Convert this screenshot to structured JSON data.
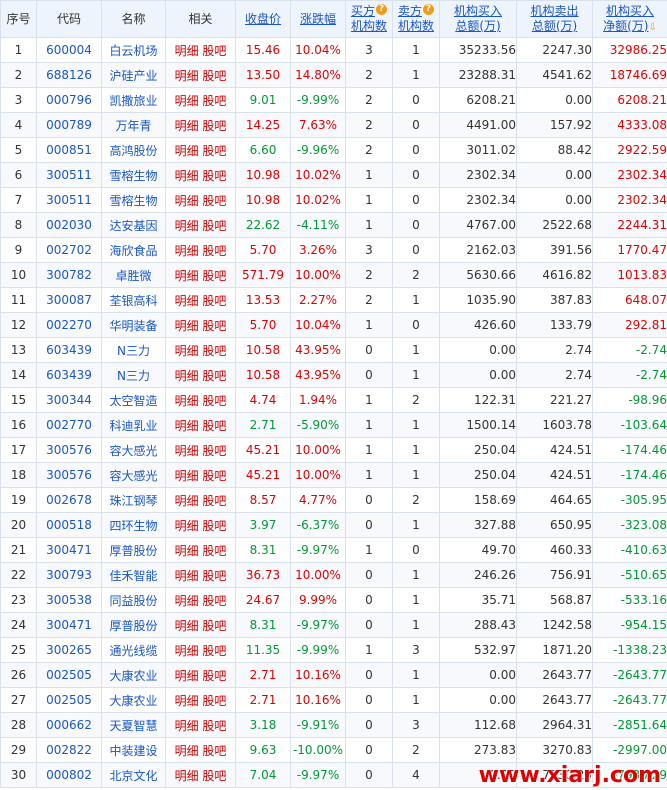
{
  "headers": {
    "seq": "序号",
    "code": "代码",
    "name": "名称",
    "related": "相关",
    "close": "收盘价",
    "change": "涨跌幅",
    "buy_inst": [
      "买方",
      "机构数"
    ],
    "sell_inst": [
      "卖方",
      "机构数"
    ],
    "inst_buy_total": [
      "机构买入",
      "总额(万)"
    ],
    "inst_sell_total": [
      "机构卖出",
      "总额(万)"
    ],
    "inst_net": [
      "机构买入",
      "净额(万)"
    ]
  },
  "related_links": {
    "detail": "明细",
    "forum": "股吧"
  },
  "colors": {
    "up": "#e40000",
    "down": "#009933",
    "link": "#1a56c8"
  },
  "rows": [
    {
      "seq": "1",
      "code": "600004",
      "name": "白云机场",
      "close": "15.46",
      "change": "10.04%",
      "buy": "3",
      "sell": "1",
      "buy_total": "35233.56",
      "sell_total": "2247.30",
      "net": "32986.25",
      "dir": "up",
      "netdir": "up"
    },
    {
      "seq": "2",
      "code": "688126",
      "name": "沪硅产业",
      "close": "13.50",
      "change": "14.80%",
      "buy": "2",
      "sell": "1",
      "buy_total": "23288.31",
      "sell_total": "4541.62",
      "net": "18746.69",
      "dir": "up",
      "netdir": "up"
    },
    {
      "seq": "3",
      "code": "000796",
      "name": "凯撒旅业",
      "close": "9.01",
      "change": "-9.99%",
      "buy": "2",
      "sell": "0",
      "buy_total": "6208.21",
      "sell_total": "0.00",
      "net": "6208.21",
      "dir": "down",
      "netdir": "up"
    },
    {
      "seq": "4",
      "code": "000789",
      "name": "万年青",
      "close": "14.25",
      "change": "7.63%",
      "buy": "2",
      "sell": "0",
      "buy_total": "4491.00",
      "sell_total": "157.92",
      "net": "4333.08",
      "dir": "up",
      "netdir": "up"
    },
    {
      "seq": "5",
      "code": "000851",
      "name": "高鸿股份",
      "close": "6.60",
      "change": "-9.96%",
      "buy": "2",
      "sell": "0",
      "buy_total": "3011.02",
      "sell_total": "88.42",
      "net": "2922.59",
      "dir": "down",
      "netdir": "up"
    },
    {
      "seq": "6",
      "code": "300511",
      "name": "雪榕生物",
      "close": "10.98",
      "change": "10.02%",
      "buy": "1",
      "sell": "0",
      "buy_total": "2302.34",
      "sell_total": "0.00",
      "net": "2302.34",
      "dir": "up",
      "netdir": "up"
    },
    {
      "seq": "7",
      "code": "300511",
      "name": "雪榕生物",
      "close": "10.98",
      "change": "10.02%",
      "buy": "1",
      "sell": "0",
      "buy_total": "2302.34",
      "sell_total": "0.00",
      "net": "2302.34",
      "dir": "up",
      "netdir": "up"
    },
    {
      "seq": "8",
      "code": "002030",
      "name": "达安基因",
      "close": "22.62",
      "change": "-4.11%",
      "buy": "1",
      "sell": "0",
      "buy_total": "4767.00",
      "sell_total": "2522.68",
      "net": "2244.31",
      "dir": "down",
      "netdir": "up"
    },
    {
      "seq": "9",
      "code": "002702",
      "name": "海欣食品",
      "close": "5.70",
      "change": "3.26%",
      "buy": "3",
      "sell": "0",
      "buy_total": "2162.03",
      "sell_total": "391.56",
      "net": "1770.47",
      "dir": "up",
      "netdir": "up"
    },
    {
      "seq": "10",
      "code": "300782",
      "name": "卓胜微",
      "close": "571.79",
      "change": "10.00%",
      "buy": "2",
      "sell": "2",
      "buy_total": "5630.66",
      "sell_total": "4616.82",
      "net": "1013.83",
      "dir": "up",
      "netdir": "up"
    },
    {
      "seq": "11",
      "code": "300087",
      "name": "荃银高科",
      "close": "13.53",
      "change": "2.27%",
      "buy": "2",
      "sell": "1",
      "buy_total": "1035.90",
      "sell_total": "387.83",
      "net": "648.07",
      "dir": "up",
      "netdir": "up"
    },
    {
      "seq": "12",
      "code": "002270",
      "name": "华明装备",
      "close": "5.70",
      "change": "10.04%",
      "buy": "1",
      "sell": "0",
      "buy_total": "426.60",
      "sell_total": "133.79",
      "net": "292.81",
      "dir": "up",
      "netdir": "up"
    },
    {
      "seq": "13",
      "code": "603439",
      "name": "N三力",
      "close": "10.58",
      "change": "43.95%",
      "buy": "0",
      "sell": "1",
      "buy_total": "0.00",
      "sell_total": "2.74",
      "net": "-2.74",
      "dir": "up",
      "netdir": "down"
    },
    {
      "seq": "14",
      "code": "603439",
      "name": "N三力",
      "close": "10.58",
      "change": "43.95%",
      "buy": "0",
      "sell": "1",
      "buy_total": "0.00",
      "sell_total": "2.74",
      "net": "-2.74",
      "dir": "up",
      "netdir": "down"
    },
    {
      "seq": "15",
      "code": "300344",
      "name": "太空智造",
      "close": "4.74",
      "change": "1.94%",
      "buy": "1",
      "sell": "2",
      "buy_total": "122.31",
      "sell_total": "221.27",
      "net": "-98.96",
      "dir": "up",
      "netdir": "down"
    },
    {
      "seq": "16",
      "code": "002770",
      "name": "科迪乳业",
      "close": "2.71",
      "change": "-5.90%",
      "buy": "1",
      "sell": "1",
      "buy_total": "1500.14",
      "sell_total": "1603.78",
      "net": "-103.64",
      "dir": "down",
      "netdir": "down"
    },
    {
      "seq": "17",
      "code": "300576",
      "name": "容大感光",
      "close": "45.21",
      "change": "10.00%",
      "buy": "1",
      "sell": "1",
      "buy_total": "250.04",
      "sell_total": "424.51",
      "net": "-174.46",
      "dir": "up",
      "netdir": "down"
    },
    {
      "seq": "18",
      "code": "300576",
      "name": "容大感光",
      "close": "45.21",
      "change": "10.00%",
      "buy": "1",
      "sell": "1",
      "buy_total": "250.04",
      "sell_total": "424.51",
      "net": "-174.46",
      "dir": "up",
      "netdir": "down"
    },
    {
      "seq": "19",
      "code": "002678",
      "name": "珠江钢琴",
      "close": "8.57",
      "change": "4.77%",
      "buy": "0",
      "sell": "2",
      "buy_total": "158.69",
      "sell_total": "464.65",
      "net": "-305.95",
      "dir": "up",
      "netdir": "down"
    },
    {
      "seq": "20",
      "code": "000518",
      "name": "四环生物",
      "close": "3.97",
      "change": "-6.37%",
      "buy": "0",
      "sell": "1",
      "buy_total": "327.88",
      "sell_total": "650.95",
      "net": "-323.08",
      "dir": "down",
      "netdir": "down"
    },
    {
      "seq": "21",
      "code": "300471",
      "name": "厚普股份",
      "close": "8.31",
      "change": "-9.97%",
      "buy": "1",
      "sell": "0",
      "buy_total": "49.70",
      "sell_total": "460.33",
      "net": "-410.63",
      "dir": "down",
      "netdir": "down"
    },
    {
      "seq": "22",
      "code": "300793",
      "name": "佳禾智能",
      "close": "36.73",
      "change": "10.00%",
      "buy": "0",
      "sell": "1",
      "buy_total": "246.26",
      "sell_total": "756.91",
      "net": "-510.65",
      "dir": "up",
      "netdir": "down"
    },
    {
      "seq": "23",
      "code": "300538",
      "name": "同益股份",
      "close": "24.67",
      "change": "9.99%",
      "buy": "0",
      "sell": "1",
      "buy_total": "35.71",
      "sell_total": "568.87",
      "net": "-533.16",
      "dir": "up",
      "netdir": "down"
    },
    {
      "seq": "24",
      "code": "300471",
      "name": "厚普股份",
      "close": "8.31",
      "change": "-9.97%",
      "buy": "0",
      "sell": "1",
      "buy_total": "288.43",
      "sell_total": "1242.58",
      "net": "-954.15",
      "dir": "down",
      "netdir": "down"
    },
    {
      "seq": "25",
      "code": "300265",
      "name": "通光线缆",
      "close": "11.35",
      "change": "-9.99%",
      "buy": "1",
      "sell": "3",
      "buy_total": "532.97",
      "sell_total": "1871.20",
      "net": "-1338.23",
      "dir": "down",
      "netdir": "down"
    },
    {
      "seq": "26",
      "code": "002505",
      "name": "大康农业",
      "close": "2.71",
      "change": "10.16%",
      "buy": "0",
      "sell": "1",
      "buy_total": "0.00",
      "sell_total": "2643.77",
      "net": "-2643.77",
      "dir": "up",
      "netdir": "down"
    },
    {
      "seq": "27",
      "code": "002505",
      "name": "大康农业",
      "close": "2.71",
      "change": "10.16%",
      "buy": "0",
      "sell": "1",
      "buy_total": "0.00",
      "sell_total": "2643.77",
      "net": "-2643.77",
      "dir": "up",
      "netdir": "down"
    },
    {
      "seq": "28",
      "code": "000662",
      "name": "天夏智慧",
      "close": "3.18",
      "change": "-9.91%",
      "buy": "0",
      "sell": "3",
      "buy_total": "112.68",
      "sell_total": "2964.31",
      "net": "-2851.64",
      "dir": "down",
      "netdir": "down"
    },
    {
      "seq": "29",
      "code": "002822",
      "name": "中装建设",
      "close": "9.63",
      "change": "-10.00%",
      "buy": "0",
      "sell": "2",
      "buy_total": "273.83",
      "sell_total": "3270.83",
      "net": "-2997.00",
      "dir": "down",
      "netdir": "down"
    },
    {
      "seq": "30",
      "code": "000802",
      "name": "北京文化",
      "close": "7.04",
      "change": "-9.97%",
      "buy": "0",
      "sell": "4",
      "buy_total": "0.00",
      "sell_total": "7930.29",
      "net": "-7930.29",
      "dir": "down",
      "netdir": "down"
    }
  ],
  "watermark": "www.xiarj.com"
}
